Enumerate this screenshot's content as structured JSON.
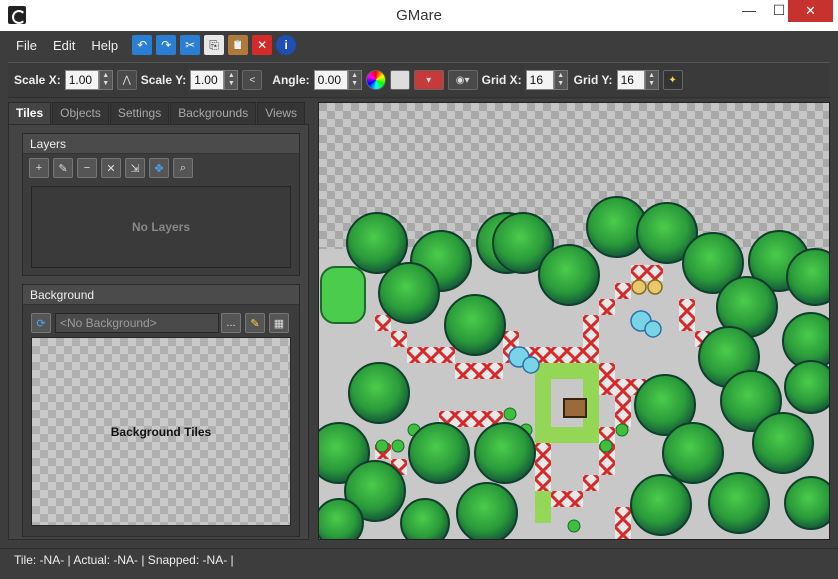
{
  "window": {
    "title": "GMare",
    "minimize": "—",
    "maximize": "☐",
    "close": "✕"
  },
  "menu": {
    "items": [
      "File",
      "Edit",
      "Help"
    ],
    "toolbar": {
      "undo": "↶",
      "redo": "↷",
      "cut": "✂",
      "copy": "⎘",
      "paste": "📋",
      "delete": "✕",
      "info": "i"
    }
  },
  "props": {
    "scale_x_label": "Scale X:",
    "scale_x": "1.00",
    "scale_y_label": "Scale Y:",
    "scale_y": "1.00",
    "angle_label": "Angle:",
    "angle": "0.00",
    "grid_x_label": "Grid X:",
    "grid_x": "16",
    "grid_y_label": "Grid Y:",
    "grid_y": "16"
  },
  "tabs": [
    "Tiles",
    "Objects",
    "Settings",
    "Backgrounds",
    "Views"
  ],
  "active_tab": "Tiles",
  "layers": {
    "title": "Layers",
    "empty_text": "No Layers"
  },
  "background": {
    "title": "Background",
    "combo": "<No Background>",
    "browse": "...",
    "tiles_text": "Background Tiles"
  },
  "status": {
    "text": "Tile: -NA- | Actual: -NA- | Snapped: -NA- |"
  },
  "colors": {
    "accent_blue": "#2a7fd4",
    "close_red": "#c7312e",
    "canvas_ground": "#c8c8c8",
    "tree_green": "#2e9a3a"
  }
}
